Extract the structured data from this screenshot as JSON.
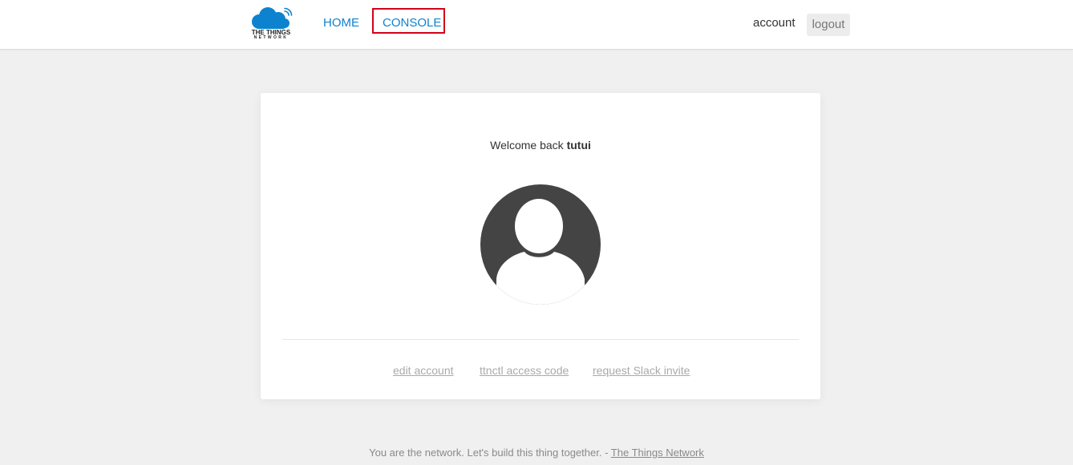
{
  "header": {
    "logo": {
      "line1": "THE THINGS",
      "line2": "NETWORK",
      "icon": "cloud-wifi-icon",
      "color": "#0d83d0"
    },
    "nav": {
      "home_label": "HOME",
      "console_label": "CONSOLE"
    },
    "account_label": "account",
    "logout_label": "logout"
  },
  "card": {
    "welcome_prefix": "Welcome back ",
    "username": "tutui",
    "avatar_icon": "user-avatar-icon",
    "links": {
      "edit_account": "edit account",
      "ttnctl_access_code": "ttnctl access code",
      "request_slack_invite": "request Slack invite"
    }
  },
  "footer": {
    "text": "You are the network. Let's build this thing together. - ",
    "link_label": "The Things Network"
  },
  "colors": {
    "accent": "#0d83d0",
    "highlight_border": "#d0021b",
    "avatar": "#444444",
    "background": "#f0f0f0"
  }
}
